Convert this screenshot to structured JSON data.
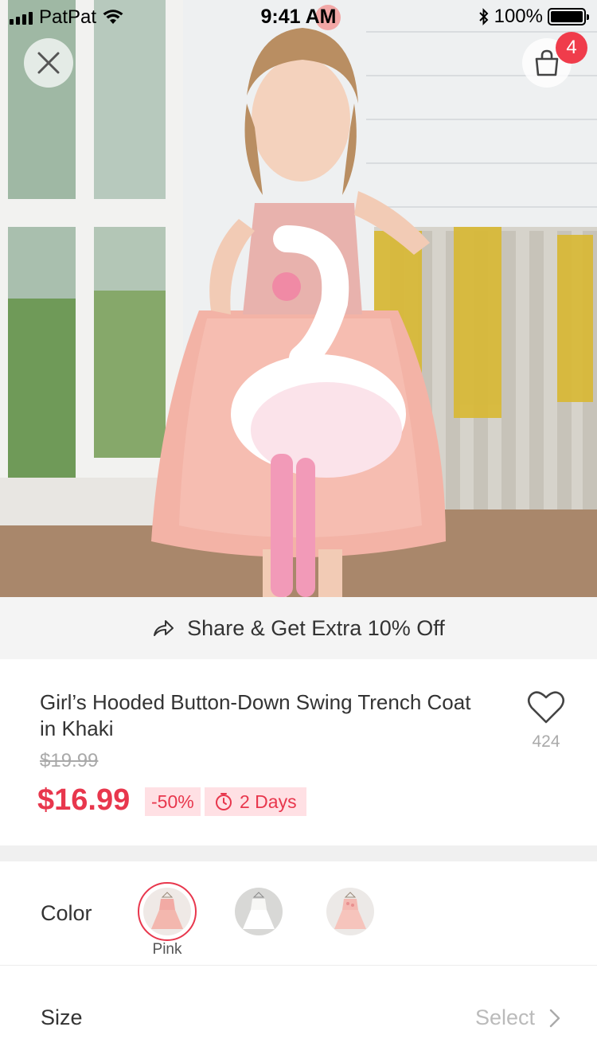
{
  "status_bar": {
    "carrier": "PatPat",
    "time": "9:41 AM",
    "battery": "100%"
  },
  "hero": {
    "image_desc": "girl-in-pink-tulle-dress-holding-flamingo",
    "close_icon": "close-icon",
    "cart_icon": "shopping-bag-icon",
    "cart_count": "4"
  },
  "share": {
    "icon": "share-arrow-icon",
    "label": "Share & Get Extra 10% Off"
  },
  "product": {
    "title": "Girl’s Hooded Button-Down Swing Trench Coat in Khaki",
    "original_price": "$19.99",
    "price": "$16.99",
    "discount": "-50%",
    "timer_icon": "timer-icon",
    "timer_label": "2 Days",
    "favorite_icon": "heart-icon",
    "favorite_count": "424"
  },
  "options": {
    "color_label": "Color",
    "selected_color": "Pink",
    "swatches": [
      "pink",
      "white",
      "pink-floral"
    ],
    "size_label": "Size",
    "size_value": "Select"
  },
  "colors": {
    "accent": "#e8374d",
    "badge": "#f03c4b",
    "tag_bg": "#ffe0e4",
    "banner_bg": "#f4f4f4"
  }
}
